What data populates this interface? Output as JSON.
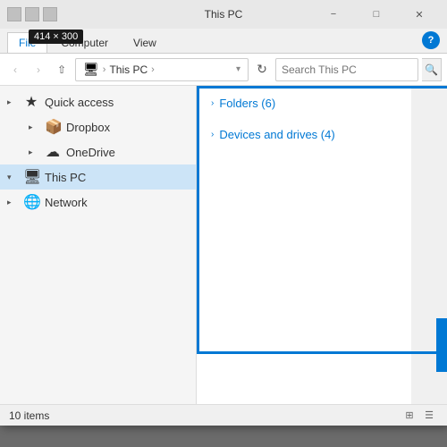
{
  "titleBar": {
    "title": "This PC",
    "minimizeLabel": "−",
    "maximizeLabel": "□",
    "closeLabel": "✕"
  },
  "dimensionBadge": {
    "text": "414 × 300"
  },
  "ribbonTabs": {
    "tabs": [
      "File",
      "Computer",
      "View"
    ],
    "activeTab": "File"
  },
  "helpButton": {
    "label": "?"
  },
  "addressBar": {
    "backButton": "‹",
    "forwardButton": "›",
    "upButton": "↑",
    "pcIcon": "🖥",
    "pathParts": [
      "This PC"
    ],
    "separator": "›",
    "dropdownArrow": "▾",
    "refreshButton": "↻",
    "searchPlaceholder": "Search This PC",
    "searchButtonIcon": "🔍"
  },
  "navPanel": {
    "items": [
      {
        "id": "quick-access",
        "label": "Quick access",
        "icon": "★",
        "expanded": true,
        "selected": false,
        "indent": 0
      },
      {
        "id": "dropbox",
        "label": "Dropbox",
        "icon": "📦",
        "expanded": false,
        "selected": false,
        "indent": 1
      },
      {
        "id": "onedrive",
        "label": "OneDrive",
        "icon": "☁",
        "expanded": false,
        "selected": false,
        "indent": 1
      },
      {
        "id": "this-pc",
        "label": "This PC",
        "icon": "🖥",
        "expanded": true,
        "selected": true,
        "indent": 0
      },
      {
        "id": "network",
        "label": "Network",
        "icon": "🌐",
        "expanded": false,
        "selected": false,
        "indent": 0
      }
    ]
  },
  "contentPanel": {
    "sections": [
      {
        "id": "folders",
        "title": "Folders (6)",
        "chevron": "›"
      },
      {
        "id": "devices",
        "title": "Devices and drives (4)",
        "chevron": "›"
      }
    ]
  },
  "statusBar": {
    "itemCount": "10 items",
    "viewIconGrid": "⊞",
    "viewIconList": "☰"
  }
}
